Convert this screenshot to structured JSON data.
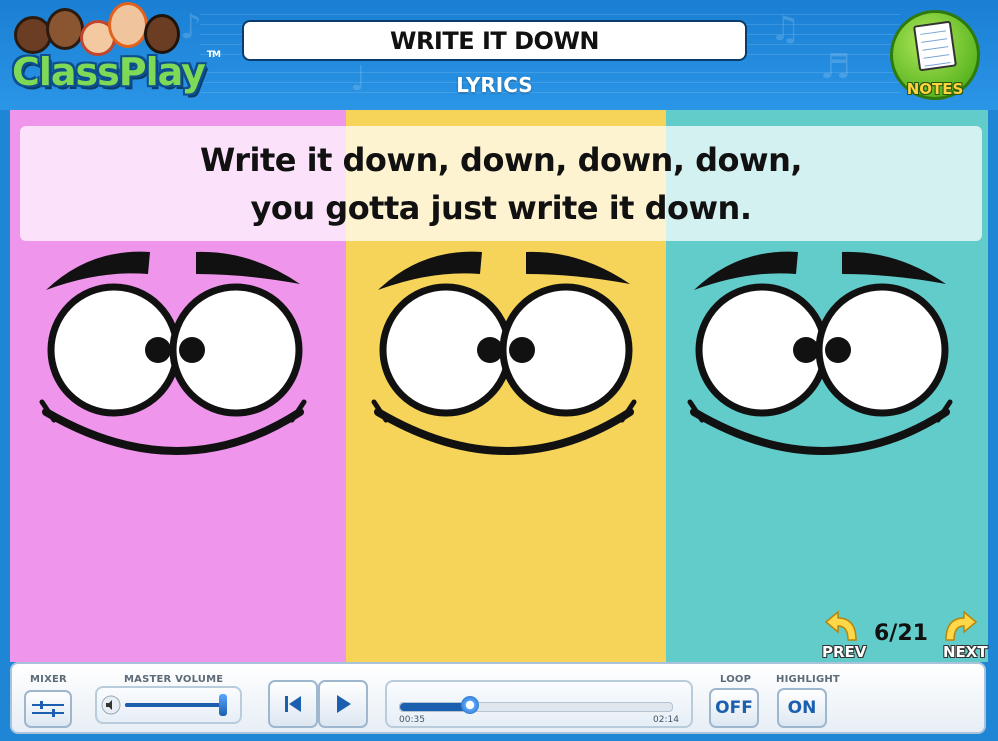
{
  "app": {
    "logo_text": "ClassPlay",
    "logo_tm": "TM"
  },
  "header": {
    "title": "WRITE IT DOWN",
    "subtitle": "LYRICS",
    "notes_label": "NOTES"
  },
  "lyrics": {
    "lines": [
      "Write it down, down, down, down,",
      "you gotta just write it down."
    ]
  },
  "panels": [
    {
      "color": "#ef96ec"
    },
    {
      "color": "#f6d45a"
    },
    {
      "color": "#62cccb"
    }
  ],
  "navigation": {
    "prev_label": "PREV",
    "next_label": "NEXT",
    "page": "6/21"
  },
  "controls": {
    "mixer_label": "MIXER",
    "volume_label": "MASTER VOLUME",
    "volume_level": 1.0,
    "elapsed": "00:35",
    "duration": "02:14",
    "progress": 0.26,
    "loop_label": "LOOP",
    "loop_value": "OFF",
    "highlight_label": "HIGHLIGHT",
    "highlight_value": "ON"
  },
  "icons": [
    "notepad-icon",
    "prev-arrow-icon",
    "next-arrow-icon",
    "mixer-icon",
    "speaker-icon",
    "skip-back-icon",
    "play-icon"
  ],
  "colors": {
    "header_blue": "#1f86d6",
    "accent_blue": "#1b5fae",
    "nav_yellow": "#ffd84a"
  }
}
